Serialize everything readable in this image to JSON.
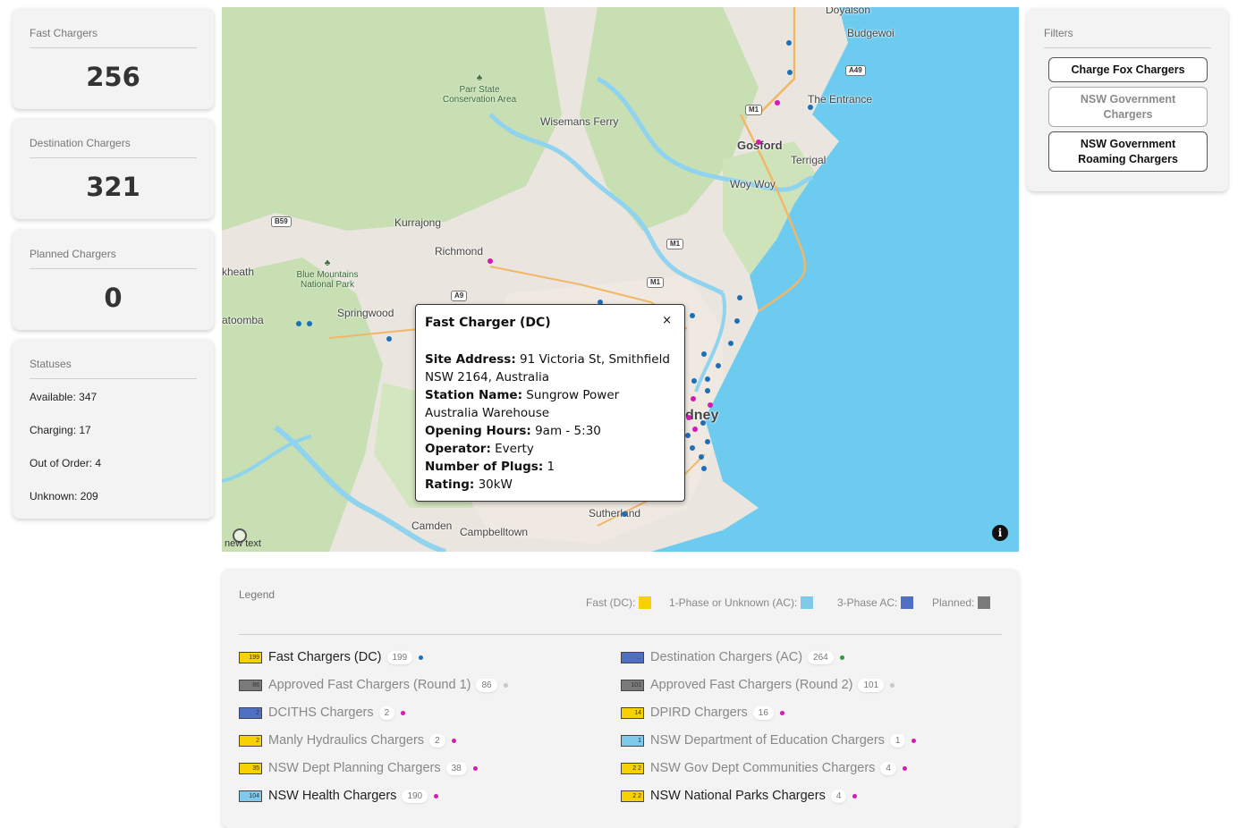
{
  "stats": {
    "fast": {
      "title": "Fast Chargers",
      "value": "256"
    },
    "destination": {
      "title": "Destination Chargers",
      "value": "321"
    },
    "planned": {
      "title": "Planned Chargers",
      "value": "0"
    }
  },
  "statuses": {
    "title": "Statuses",
    "available": "Available: 347",
    "charging": "Charging: 17",
    "out_of_order": "Out of Order: 4",
    "unknown": "Unknown: 209"
  },
  "filters": {
    "title": "Filters",
    "buttons": [
      {
        "label": "Charge Fox Chargers",
        "active": true
      },
      {
        "label": "NSW Government Chargers",
        "active": false
      },
      {
        "label": "NSW Government Roaming Chargers",
        "active": true
      }
    ]
  },
  "map": {
    "labels": {
      "doyalson": "Doyalson",
      "budgewoi": "Budgewoi",
      "the_entrance": "The Entrance",
      "gosford": "Gosford",
      "terrigal": "Terrigal",
      "woy_woy": "Woy Woy",
      "wisemans_ferry": "Wisemans Ferry",
      "kurrajong": "Kurrajong",
      "richmond": "Richmond",
      "springwood": "Springwood",
      "katoomba": "atoomba",
      "blackheath": "kheath",
      "sydney": "dney",
      "sutherland": "Sutherland",
      "camden": "Camden",
      "campbelltown": "Campbelltown"
    },
    "parks": {
      "parr": "Parr State Conservation Area",
      "blue_mountains": "Blue Mountains National Park"
    },
    "shields": {
      "a49": "A49",
      "m1a": "M1",
      "m1b": "M1",
      "m1c": "M1",
      "b59": "B59",
      "a9": "A9"
    },
    "watermark": "new text",
    "info_icon": "info-icon",
    "colors": {
      "sea": "#6ecbf0",
      "land": "#eae6df",
      "forest": "#c8dfb4",
      "water": "#8fd3ef"
    }
  },
  "popup": {
    "title": "Fast Charger (DC)",
    "close": "×",
    "site_address_label": "Site Address:",
    "site_address": "91 Victoria St, Smithfield NSW 2164, Australia",
    "station_name_label": "Station Name:",
    "station_name": "Sungrow Power Australia Warehouse",
    "opening_hours_label": "Opening Hours:",
    "opening_hours": "9am - 5:30",
    "operator_label": "Operator:",
    "operator": "Everty",
    "plugs_label": "Number of Plugs:",
    "plugs": "1",
    "rating_label": "Rating:",
    "rating": "30kW"
  },
  "legend": {
    "title": "Legend",
    "keys": {
      "fast": "Fast (DC):",
      "ac1": "1-Phase or Unknown (AC):",
      "ac3": "3-Phase AC:",
      "planned": "Planned:"
    },
    "key_colors": {
      "fast": "#f7d200",
      "ac1": "#7fc9ea",
      "ac3": "#4f6fc4",
      "planned": "#7a7a7a"
    },
    "items": [
      {
        "name": "Fast Chargers (DC)",
        "count": "199",
        "icon_text": "199",
        "active": true,
        "dot": "#1d6fb8",
        "icon_color": "#f7d200"
      },
      {
        "name": "Destination Chargers (AC)",
        "count": "264",
        "icon_text": "...",
        "active": false,
        "dot": "#2a9d3a",
        "icon_color": "#4f6fc4"
      },
      {
        "name": "Approved Fast Chargers (Round 1)",
        "count": "86",
        "icon_text": "86",
        "active": false,
        "dot": "#c8c8c8",
        "icon_color": "#7a7a7a"
      },
      {
        "name": "Approved Fast Chargers (Round 2)",
        "count": "101",
        "icon_text": "101",
        "active": false,
        "dot": "#c8c8c8",
        "icon_color": "#7a7a7a"
      },
      {
        "name": "DCITHS Chargers",
        "count": "2",
        "icon_text": "2",
        "active": false,
        "dot": "#d618b4",
        "icon_color": "#4f6fc4"
      },
      {
        "name": "DPIRD Chargers",
        "count": "16",
        "icon_text": "14",
        "active": false,
        "dot": "#d618b4",
        "icon_color": "#f7d200"
      },
      {
        "name": "Manly Hydraulics Chargers",
        "count": "2",
        "icon_text": "2",
        "active": false,
        "dot": "#d618b4",
        "icon_color": "#f7d200"
      },
      {
        "name": "NSW Department of Education Chargers",
        "count": "1",
        "icon_text": "1",
        "active": false,
        "dot": "#d618b4",
        "icon_color": "#7fc9ea"
      },
      {
        "name": "NSW Dept Planning Chargers",
        "count": "38",
        "icon_text": "35",
        "active": false,
        "dot": "#d618b4",
        "icon_color": "#f7d200"
      },
      {
        "name": "NSW Gov Dept Communities Chargers",
        "count": "4",
        "icon_text": "2 2",
        "active": false,
        "dot": "#d618b4",
        "icon_color": "#f7d200"
      },
      {
        "name": "NSW Health Chargers",
        "count": "190",
        "icon_text": "104",
        "active": true,
        "dot": "#d618b4",
        "icon_color": "#7fc9ea"
      },
      {
        "name": "NSW National Parks Chargers",
        "count": "4",
        "icon_text": "2 2",
        "active": true,
        "dot": "#d618b4",
        "icon_color": "#f7d200"
      }
    ]
  }
}
